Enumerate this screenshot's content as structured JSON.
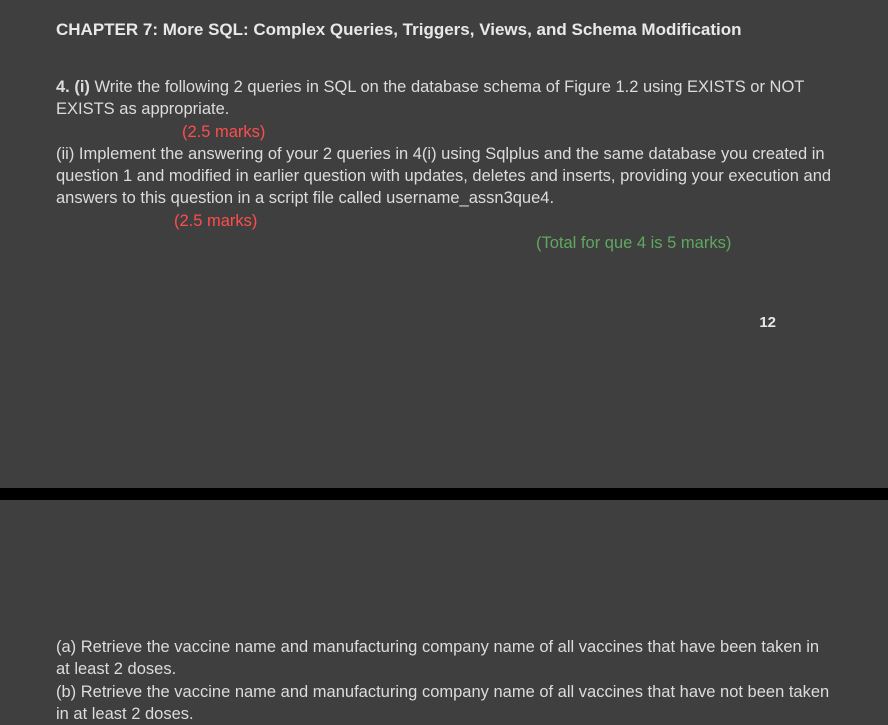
{
  "chapter": {
    "title": "CHAPTER 7: More SQL: Complex Queries, Triggers, Views, and Schema Modification"
  },
  "question4": {
    "part_i_label": "4. (i) ",
    "part_i_text": "Write the following 2 queries in SQL on the database schema of Figure 1.2 using EXISTS or NOT EXISTS as appropriate.",
    "part_i_marks": "(2.5 marks)",
    "part_ii_text": "(ii) Implement the answering of your 2 queries in 4(i) using Sqlplus and the same database you created in question 1 and modified in earlier question with updates, deletes and inserts, providing your execution and answers to this question in a script file called username_assn3que4.",
    "part_ii_marks": "(2.5 marks)",
    "total": "(Total for que 4 is 5 marks)"
  },
  "page_number": "12",
  "answers": {
    "a": "(a)  Retrieve the vaccine name and manufacturing company name of all vaccines that have been taken in at least 2 doses.",
    "b": "(b) Retrieve the vaccine name and manufacturing company name of all vaccines that have not been taken in at least 2 doses."
  }
}
